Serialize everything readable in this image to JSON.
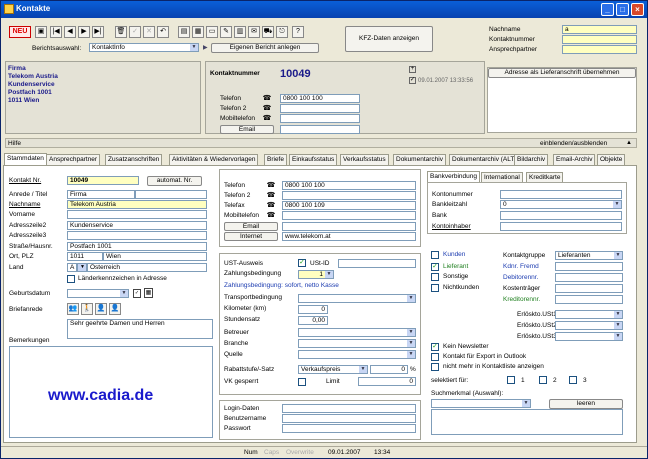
{
  "window": {
    "title": "Kontakte"
  },
  "toolbar": {
    "new_label": "NEU",
    "kfz_button": "KFZ-Daten anzeigen",
    "berichtsauswahl_label": "Berichtsauswahl:",
    "berichtsauswahl_value": "KontaktInfo",
    "eigener_bericht_button": "Eigenen Bericht anlegen"
  },
  "top_right": {
    "nachname_label": "Nachname",
    "nachname_value": "a",
    "kontaktnummer_label": "Kontaktnummer",
    "ansprechpartner_label": "Ansprechpartner"
  },
  "address_block": {
    "lines": [
      "Firma",
      "Telekom Austria",
      "Kundenservice",
      "Postfach  1001",
      "1011  Wien"
    ]
  },
  "header_contact": {
    "kontaktnummer_label": "Kontaktnummer",
    "kontaktnummer_value": "10049",
    "timestamp": "09.01.2007 13:33:56",
    "telefon_label": "Telefon",
    "telefon_value": "0800 100 100",
    "telefon2_label": "Telefon 2",
    "mobil_label": "Mobiltelefon",
    "email_button": "Email"
  },
  "lieferanschrift_button": "Adresse als Lieferanschrift übernehmen",
  "hilfe": {
    "label": "Hilfe",
    "toggle": "einblenden/ausblenden"
  },
  "tabs": [
    "Stammdaten",
    "Ansprechpartner",
    "Zusatzanschriften",
    "Aktivitäten & Wiedervorlagen",
    "Briefe",
    "Einkaufsstatus",
    "Verkaufsstatus",
    "Dokumentarchiv",
    "Dokumentarchiv (ALT)",
    "Bildarchiv",
    "Email-Archiv",
    "Objekte"
  ],
  "left": {
    "kontakt_nr_label": "Kontakt Nr.",
    "kontakt_nr_value": "10049",
    "automat_button": "automat. Nr.",
    "anrede_label": "Anrede / Titel",
    "anrede_value": "Firma",
    "nachname_label": "Nachname",
    "nachname_value": "Telekom Austria",
    "vorname_label": "Vorname",
    "adresszeile2_label": "Adresszeile2",
    "adresszeile2_value": "Kundenservice",
    "adresszeile3_label": "Adresszeile3",
    "strasse_label": "Straße/Hausnr.",
    "strasse_value": "Postfach  1001",
    "ort_label": "Ort, PLZ",
    "plz_value": "1011",
    "ort_value": "Wien",
    "land_label": "Land",
    "land_code": "A",
    "land_value": "Österreich",
    "laenderkennzeichen_label": "Länderkennzeichen in Adresse",
    "geburtsdatum_label": "Geburtsdatum",
    "briefanrede_label": "Briefanrede",
    "briefanrede_value": "Sehr geehrte Damen und Herren",
    "bemerkungen_label": "Bemerkungen",
    "watermark": "www.cadia.de"
  },
  "middle": {
    "telefon_label": "Telefon",
    "telefon_value": "0800 100 100",
    "telefon2_label": "Telefon 2",
    "telefax_label": "Telefax",
    "telefax_value": "0800 100 109",
    "mobil_label": "Mobiltelefon",
    "email_button": "Email",
    "internet_button": "Internet",
    "internet_value": "www.telekom.at",
    "ust_label": "UST-Ausweis",
    "ust_id_label": "USt-ID",
    "zahlungsbedingung_label": "Zahlungsbedingung",
    "zahlungsbedingung_value": "1",
    "zahlungsbedingung_text": "Zahlungsbedingung: sofort, netto Kasse",
    "transport_label": "Transportbedingung",
    "kilometer_label": "Kilometer (km)",
    "kilometer_value": "0",
    "stundensatz_label": "Stundensatz",
    "stundensatz_value": "0,00",
    "betreuer_label": "Betreuer",
    "branche_label": "Branche",
    "quelle_label": "Quelle",
    "rabatt_label": "Rabattstufe/-Satz",
    "rabatt_value": "Verkaufspreis",
    "rabatt_pct": "0",
    "rabatt_unit": "%",
    "vk_label": "VK gesperrt",
    "limit_label": "Limit",
    "limit_value": "0",
    "login_label": "Login-Daten",
    "benutzer_label": "Benutzername",
    "passwort_label": "Passwort"
  },
  "right": {
    "subtabs": [
      "Bankverbindung",
      "International",
      "Kreditkarte"
    ],
    "kontonummer_label": "Kontonummer",
    "bankleitzahl_label": "Bankleitzahl",
    "bankleitzahl_value": "0",
    "bank_label": "Bank",
    "kontoinhaber_label": "Kontoinhaber",
    "kunden_label": "Kunden",
    "lieferant_label": "Lieferant",
    "sonstige_label": "Sonstige",
    "nichtkunden_label": "Nichtkunden",
    "kontaktgruppe_label": "Kontaktgruppe",
    "kontaktgruppe_value": "Lieferanten",
    "kdnr_label": "Kdnr. Fremd",
    "debitoren_label": "Debitorennr.",
    "kostentraeger_label": "Kostenträger",
    "kreditoren_label": "Kreditorennr.",
    "erloes1_label": "Erlöskto.USt1",
    "erloes2_label": "Erlöskto.USt2",
    "erloes3_label": "Erlöskto.USt3",
    "newsletter_label": "Kein Newsletter",
    "outlook_label": "Kontakt für Export in Outlook",
    "nicht_mehr_label": "nicht mehr in Kontaktliste anzeigen",
    "selektiert_label": "selektiert für:",
    "sel1": "1",
    "sel2": "2",
    "sel3": "3",
    "suchmerkmal_label": "Suchmerkmal (Auswahl):",
    "leeren_button": "leeren"
  },
  "statusbar": {
    "num": "Num",
    "caps": "Caps",
    "overwrite": "Overwrite",
    "date": "09.01.2007",
    "time": "13:34"
  }
}
